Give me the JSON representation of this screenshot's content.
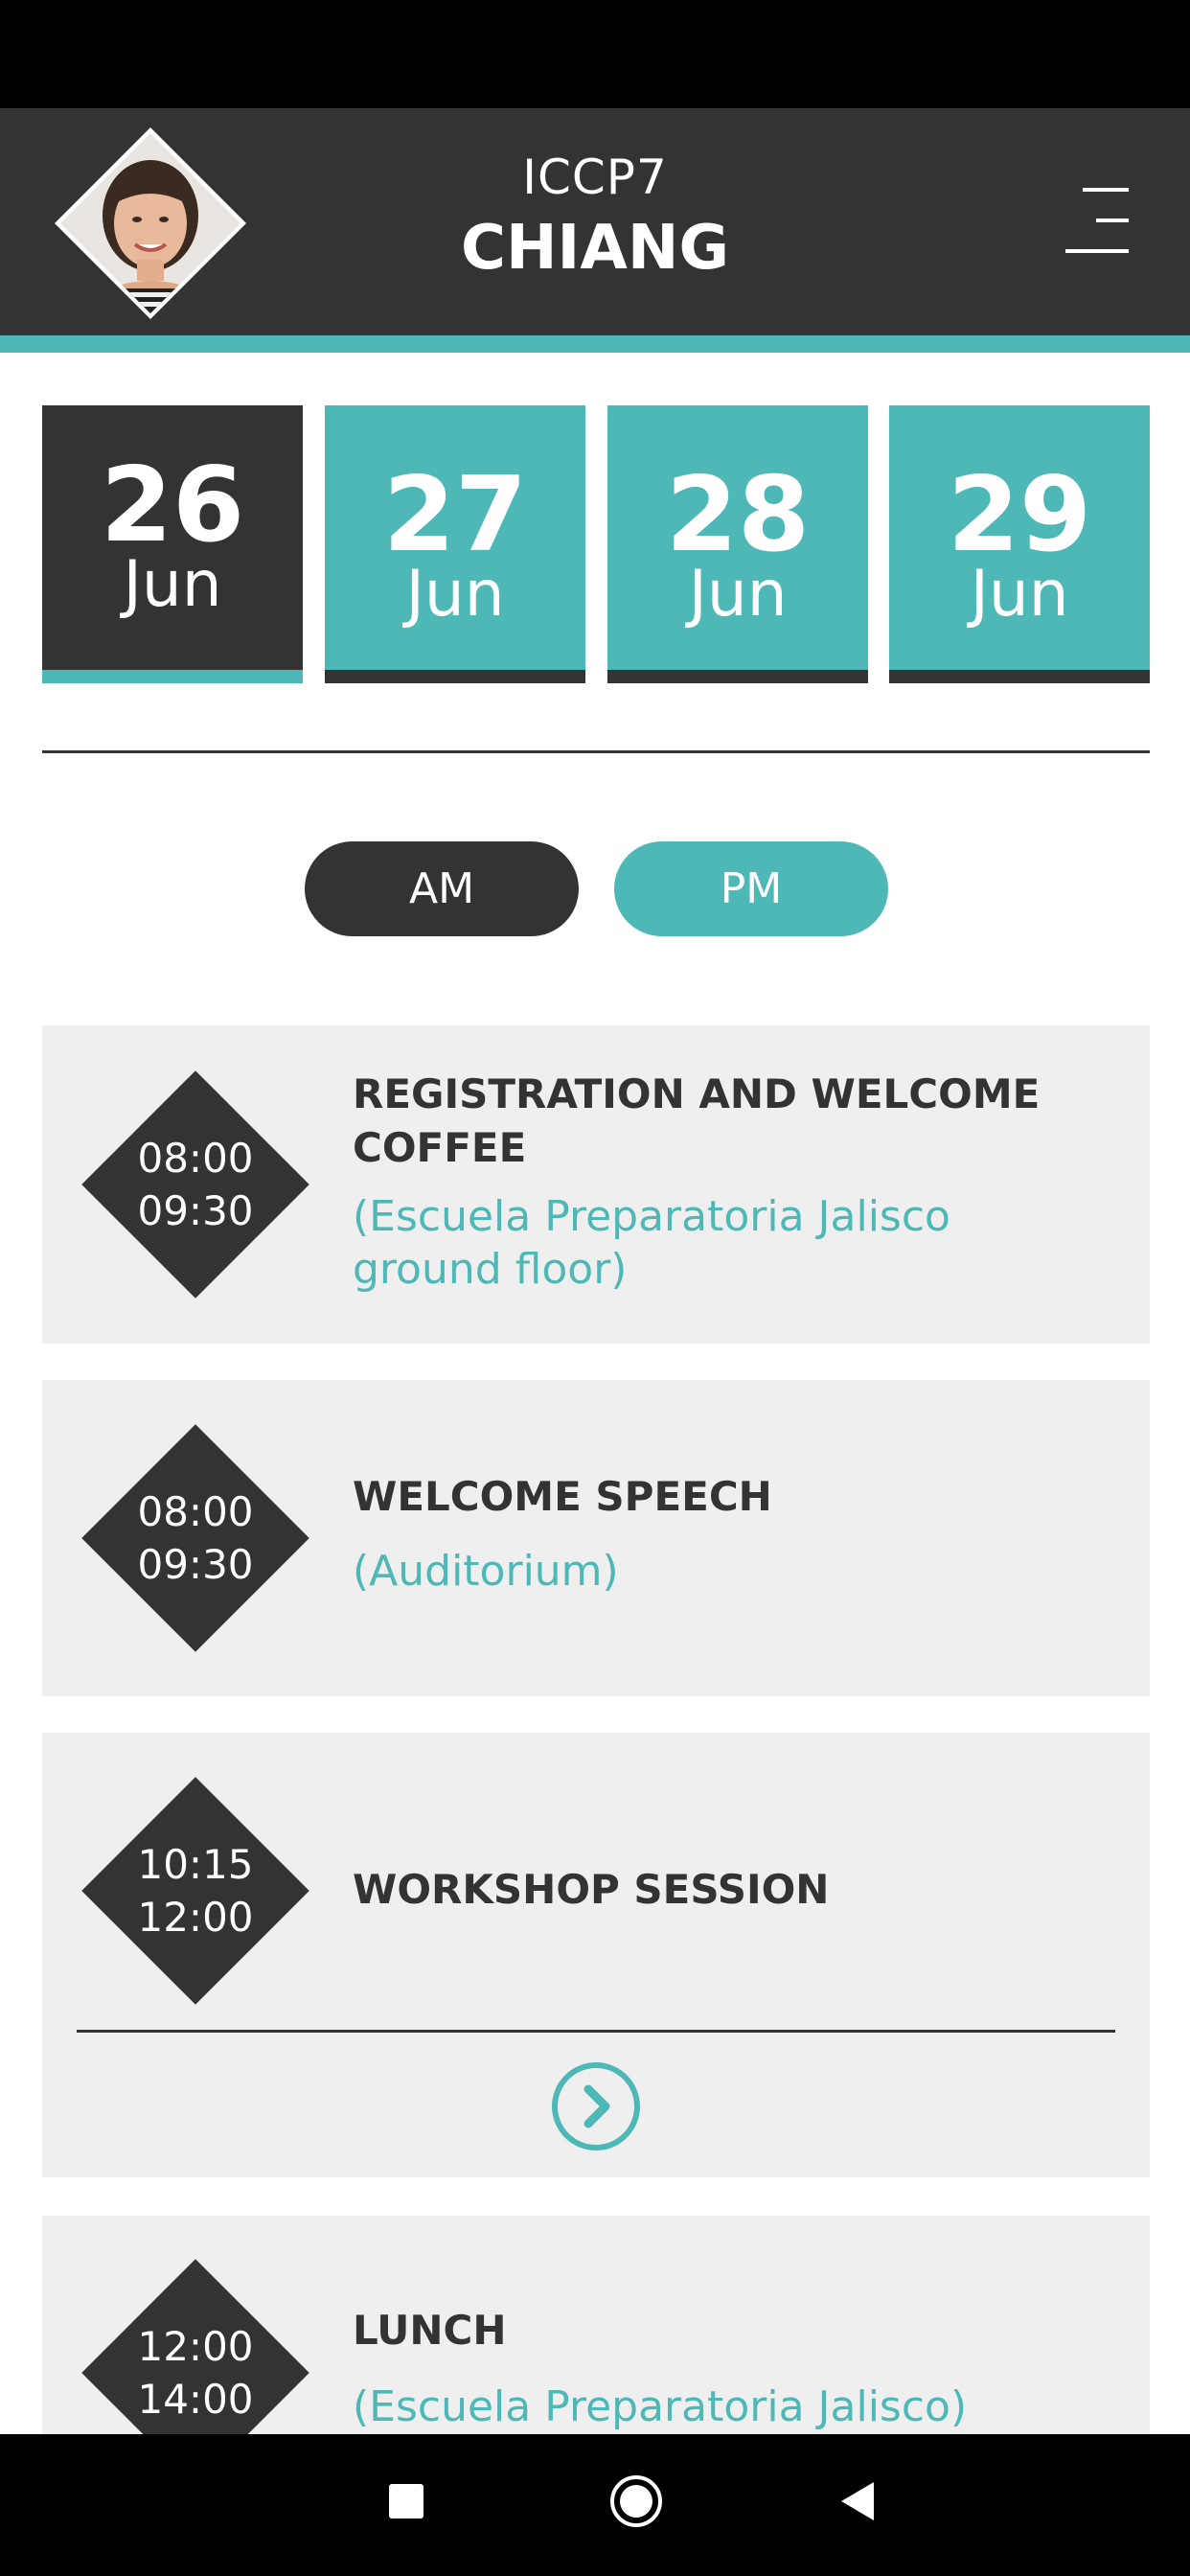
{
  "header": {
    "subtitle": "ICCP7",
    "title": "CHIANG"
  },
  "dates": [
    {
      "day": "26",
      "month": "Jun",
      "active": true
    },
    {
      "day": "27",
      "month": "Jun",
      "active": false
    },
    {
      "day": "28",
      "month": "Jun",
      "active": false
    },
    {
      "day": "29",
      "month": "Jun",
      "active": false
    }
  ],
  "period_toggle": {
    "am": "AM",
    "pm": "PM",
    "selected": "AM"
  },
  "events": [
    {
      "start": "08:00",
      "end": "09:30",
      "title_line1": "REGISTRATION AND WELCOME",
      "title_line2": "COFFEE",
      "location_line1": "(Escuela Preparatoria Jalisco",
      "location_line2": "ground floor)"
    },
    {
      "start": "08:00",
      "end": "09:30",
      "title": "WELCOME SPEECH",
      "location": "(Auditorium)"
    },
    {
      "start": "10:15",
      "end": "12:00",
      "title": "WORKSHOP SESSION"
    },
    {
      "start": "12:00",
      "end": "14:00",
      "title": "LUNCH",
      "location": "(Escuela Preparatoria Jalisco)"
    }
  ],
  "colors": {
    "accent": "#4db8b6",
    "dark": "#333333",
    "card_bg": "#efefef"
  },
  "icons": {
    "menu": "menu-icon",
    "expand": "chevron-right-circle-icon",
    "nav_recent": "square-icon",
    "nav_home": "circle-icon",
    "nav_back": "triangle-back-icon"
  }
}
